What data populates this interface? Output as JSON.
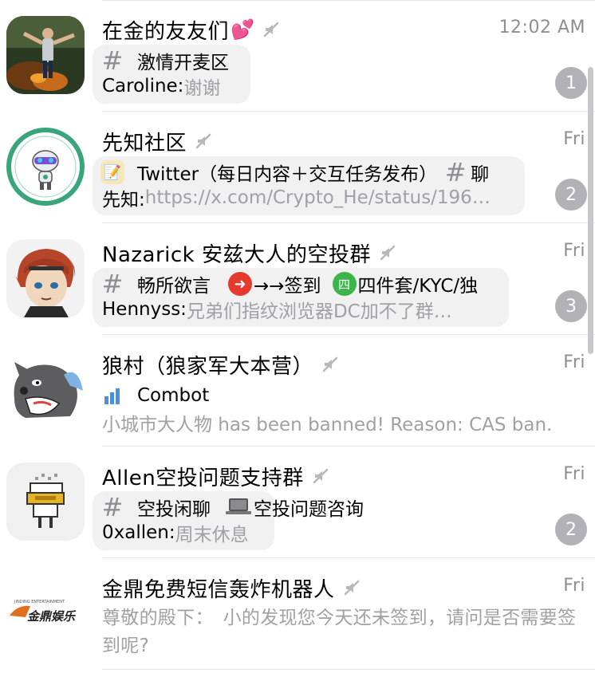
{
  "chats": [
    {
      "title": "在金的友友们",
      "title_emoji": "💕",
      "time": "12:02 AM",
      "topic": "激情开麦区",
      "sender": "Caroline: ",
      "preview": "谢谢",
      "badge": "1"
    },
    {
      "title": "先知社区",
      "time": "Fri",
      "topic_icon": "📝",
      "topic": "Twitter（每日内容＋交互任务发布）",
      "topic2": "聊",
      "sender": "先知: ",
      "preview": "https://x.com/Crypto_He/status/196…",
      "badge": "2"
    },
    {
      "title": "Nazarick 安兹大人的空投群",
      "time": "Fri",
      "topic": "畅所欲言",
      "topic2": "→→签到",
      "topic3": "四件套/KYC/独",
      "sender": "Hennyss: ",
      "preview": "兄弟们指纹浏览器DC加不了群…",
      "badge": "3"
    },
    {
      "title": "狼村（狼家军大本营）",
      "time": "Fri",
      "topic": "Combot",
      "preview": "小城市大人物 has been banned! Reason: CAS ban."
    },
    {
      "title": "Allen空投问题支持群",
      "time": "Fri",
      "topic": "空投闲聊",
      "topic2": "空投问题咨询",
      "sender": "0xallen: ",
      "preview": "周末休息",
      "badge": "2"
    },
    {
      "title": "金鼎免费短信轰炸机器人",
      "time": "Fri",
      "preview": "尊敬的殿下：　小的发现您今天还未签到，请问是否需要签到呢?",
      "logo_text": "金鼎娱乐",
      "logo_subtext": "JINDING ENTERTAINMENT"
    }
  ],
  "colors": {
    "badge": "#b1b1b6",
    "muted_text": "#8e8e93",
    "preview_text": "#a0a0a5",
    "bubble": "#f1f1f2"
  },
  "icons": [
    "mute-icon",
    "hash-icon",
    "memo-icon",
    "arrow-right-icon",
    "number-four-icon",
    "bar-chart-icon",
    "laptop-icon"
  ]
}
